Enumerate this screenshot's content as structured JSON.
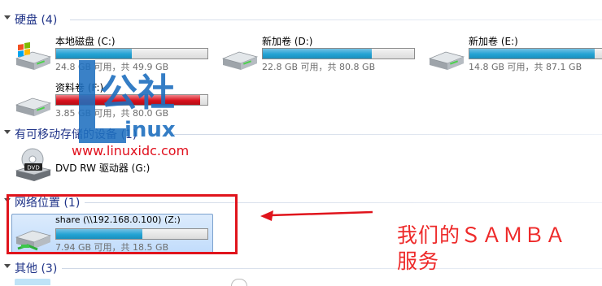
{
  "groups": {
    "hard_disks": {
      "title": "硬盘 (4)"
    },
    "removable": {
      "title": "有可移动存储的设备 (1)"
    },
    "network": {
      "title": "网络位置 (1)"
    },
    "other": {
      "title": "其他 (3)"
    }
  },
  "hard_disks": [
    {
      "name": "本地磁盘 (C:)",
      "space": "24.8 GB 可用，共 49.9 GB",
      "used_fraction": 0.5,
      "icon": "windows-drive-icon",
      "bar_color": "#24a3d4"
    },
    {
      "name": "新加卷 (D:)",
      "space": "22.8 GB 可用，共 80.8 GB",
      "used_fraction": 0.72,
      "icon": "hard-drive-icon",
      "bar_color": "#24a3d4"
    },
    {
      "name": "新加卷 (E:)",
      "space": "14.8 GB 可用，共 87.1 GB",
      "used_fraction": 0.83,
      "icon": "hard-drive-icon",
      "bar_color": "#24a3d4"
    },
    {
      "name": "资料卷 (F:)",
      "space": "3.85 GB 可用，共 80.0 GB",
      "used_fraction": 0.95,
      "icon": "hard-drive-icon",
      "bar_color": "#d9121d"
    }
  ],
  "removable": [
    {
      "name": "DVD RW 驱动器 (G:)",
      "icon": "dvd-drive-icon",
      "badge": "DVD"
    }
  ],
  "network": [
    {
      "name": "share (\\\\192.168.0.100) (Z:)",
      "space": "7.94 GB 可用，共 18.5 GB",
      "used_fraction": 0.57,
      "icon": "network-drive-icon"
    }
  ],
  "watermark": {
    "logo_text": "公社",
    "logo_sub": "inux",
    "url": "www.linuxidc.com"
  },
  "annotation": {
    "text_line1": "我们的ＳＡＭＢＡ",
    "text_line2": "服务",
    "color": "#e0141c"
  }
}
